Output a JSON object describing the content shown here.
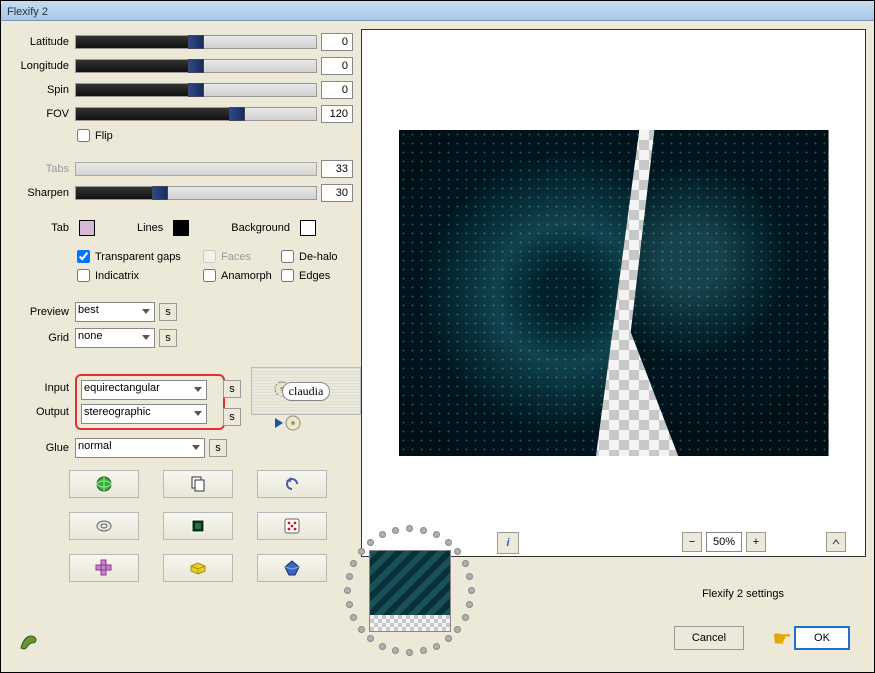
{
  "title": "Flexify 2",
  "sliders": {
    "latitude": {
      "label": "Latitude",
      "value": "0",
      "fill": 50
    },
    "longitude": {
      "label": "Longitude",
      "value": "0",
      "fill": 50
    },
    "spin": {
      "label": "Spin",
      "value": "0",
      "fill": 50
    },
    "fov": {
      "label": "FOV",
      "value": "120",
      "fill": 67
    },
    "tabs": {
      "label": "Tabs",
      "value": "33",
      "fill": 0,
      "disabled": true
    },
    "sharpen": {
      "label": "Sharpen",
      "value": "30",
      "fill": 35
    }
  },
  "flip": {
    "label": "Flip",
    "checked": false
  },
  "swatches": {
    "tab": {
      "label": "Tab",
      "color": "#d8b8d8"
    },
    "lines": {
      "label": "Lines",
      "color": "#000"
    },
    "background": {
      "label": "Background",
      "color": "#fff"
    }
  },
  "checks": {
    "transparent_gaps": {
      "label": "Transparent gaps",
      "checked": true
    },
    "faces": {
      "label": "Faces",
      "checked": false,
      "disabled": true
    },
    "dehalo": {
      "label": "De-halo",
      "checked": false
    },
    "indicatrix": {
      "label": "Indicatrix",
      "checked": false
    },
    "anamorph": {
      "label": "Anamorph",
      "checked": false
    },
    "edges": {
      "label": "Edges",
      "checked": false
    }
  },
  "dropdowns": {
    "preview": {
      "label": "Preview",
      "value": "best"
    },
    "grid": {
      "label": "Grid",
      "value": "none"
    },
    "input": {
      "label": "Input",
      "value": "equirectangular"
    },
    "output": {
      "label": "Output",
      "value": "stereographic"
    },
    "glue": {
      "label": "Glue",
      "value": "normal"
    }
  },
  "zoom": {
    "value": "50%"
  },
  "settings_label": "Flexify 2 settings",
  "buttons": {
    "cancel": "Cancel",
    "ok": "OK"
  },
  "info_glyph": "i",
  "watermark": "claudia",
  "s_label": "s"
}
